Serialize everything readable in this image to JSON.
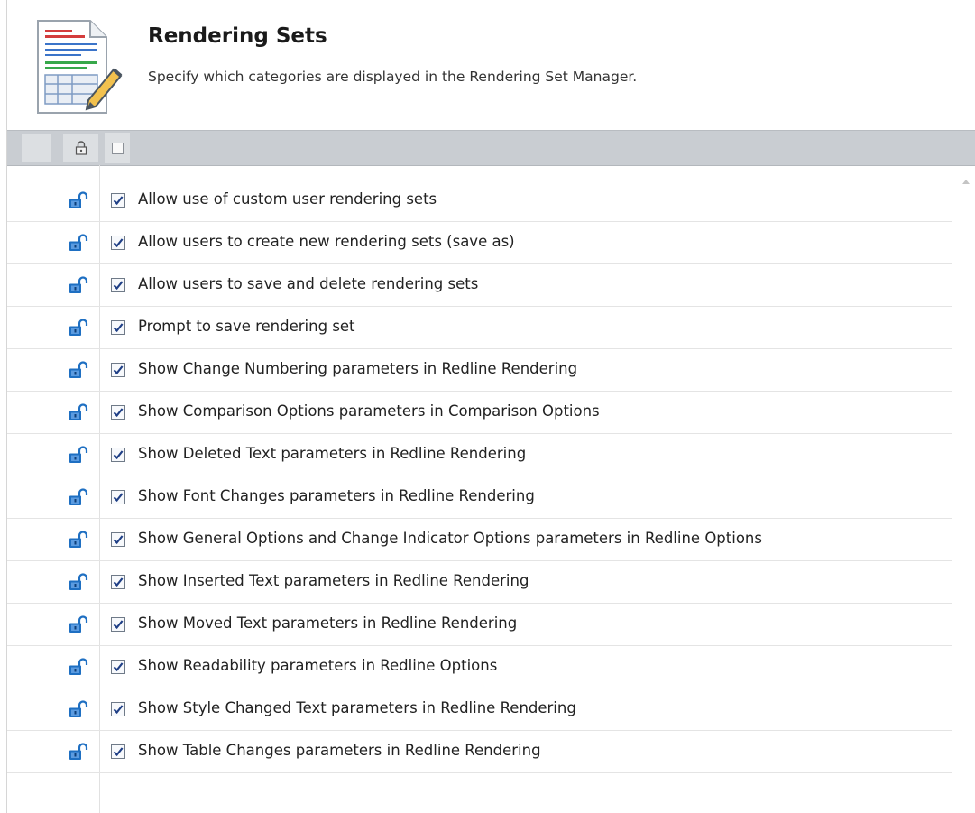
{
  "header": {
    "title": "Rendering Sets",
    "subtitle": "Specify which categories are displayed in the Rendering Set Manager."
  },
  "icons": {
    "header": "document-edit-icon",
    "lock": "lock-icon",
    "unlock": "unlocked-padlock-icon",
    "scroll": "scroll-up-arrow-icon"
  },
  "colors": {
    "lock_blue": "#1e6fc2",
    "checkbox_check": "#1f3f86",
    "header_bar": "#c9cdd2"
  },
  "header_checkbox": {
    "checked": false
  },
  "items": [
    {
      "label": "Allow use of custom user rendering sets",
      "checked": true,
      "locked": false
    },
    {
      "label": "Allow users to create new rendering sets (save as)",
      "checked": true,
      "locked": false
    },
    {
      "label": "Allow users to save and delete rendering sets",
      "checked": true,
      "locked": false
    },
    {
      "label": "Prompt to save rendering set",
      "checked": true,
      "locked": false
    },
    {
      "label": "Show Change Numbering parameters in Redline Rendering",
      "checked": true,
      "locked": false
    },
    {
      "label": "Show Comparison Options parameters in Comparison Options",
      "checked": true,
      "locked": false
    },
    {
      "label": "Show Deleted Text parameters in Redline Rendering",
      "checked": true,
      "locked": false
    },
    {
      "label": "Show Font Changes parameters in Redline Rendering",
      "checked": true,
      "locked": false
    },
    {
      "label": "Show General Options and Change Indicator Options parameters in Redline Options",
      "checked": true,
      "locked": false
    },
    {
      "label": "Show Inserted Text parameters in Redline Rendering",
      "checked": true,
      "locked": false
    },
    {
      "label": "Show Moved Text parameters in Redline Rendering",
      "checked": true,
      "locked": false
    },
    {
      "label": "Show Readability parameters in Redline Options",
      "checked": true,
      "locked": false
    },
    {
      "label": "Show Style Changed Text parameters in Redline Rendering",
      "checked": true,
      "locked": false
    },
    {
      "label": "Show Table Changes parameters in Redline Rendering",
      "checked": true,
      "locked": false
    }
  ]
}
